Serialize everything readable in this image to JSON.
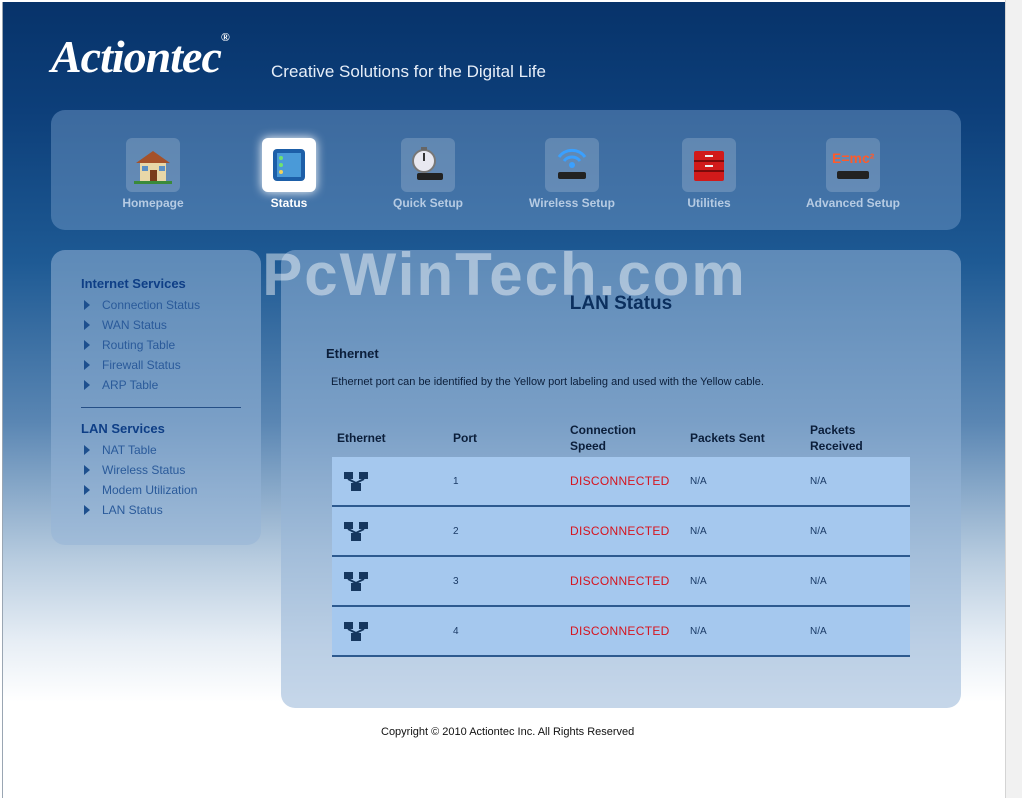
{
  "brand": {
    "logo": "Actiontec",
    "registered": "®",
    "tagline": "Creative Solutions for the Digital Life"
  },
  "nav": {
    "items": [
      {
        "label": "Homepage",
        "icon": "house-icon"
      },
      {
        "label": "Status",
        "icon": "status-icon",
        "active": true
      },
      {
        "label": "Quick Setup",
        "icon": "stopwatch-icon"
      },
      {
        "label": "Wireless Setup",
        "icon": "wireless-icon"
      },
      {
        "label": "Utilities",
        "icon": "toolbox-icon"
      },
      {
        "label": "Advanced Setup",
        "icon": "emc2-icon"
      }
    ],
    "emc2_text": "E=mc²"
  },
  "watermark": "PcWinTech.com",
  "sidebar": {
    "internet_title": "Internet Services",
    "internet_items": [
      "Connection Status",
      "WAN Status",
      "Routing Table",
      "Firewall Status",
      "ARP Table"
    ],
    "lan_title": "LAN Services",
    "lan_items": [
      "NAT Table",
      "Wireless Status",
      "Modem Utilization",
      "LAN Status"
    ]
  },
  "main": {
    "title": "LAN Status",
    "section": "Ethernet",
    "description": "Ethernet port can be identified by the Yellow port labeling and used with the Yellow cable.",
    "headers": {
      "ethernet": "Ethernet",
      "port": "Port",
      "speed_1": "Connection",
      "speed_2": "Speed",
      "sent": "Packets Sent",
      "received_1": "Packets",
      "received_2": "Received"
    },
    "rows": [
      {
        "port": "1",
        "status": "DISCONNECTED",
        "sent": "N/A",
        "received": "N/A"
      },
      {
        "port": "2",
        "status": "DISCONNECTED",
        "sent": "N/A",
        "received": "N/A"
      },
      {
        "port": "3",
        "status": "DISCONNECTED",
        "sent": "N/A",
        "received": "N/A"
      },
      {
        "port": "4",
        "status": "DISCONNECTED",
        "sent": "N/A",
        "received": "N/A"
      }
    ]
  },
  "footer": {
    "copyright": "Copyright © 2010 Actiontec Inc. All Rights Reserved"
  },
  "colors": {
    "accent": "#0e3e86",
    "status_red": "#d6141e",
    "row_bg": "#a5c8ee"
  }
}
